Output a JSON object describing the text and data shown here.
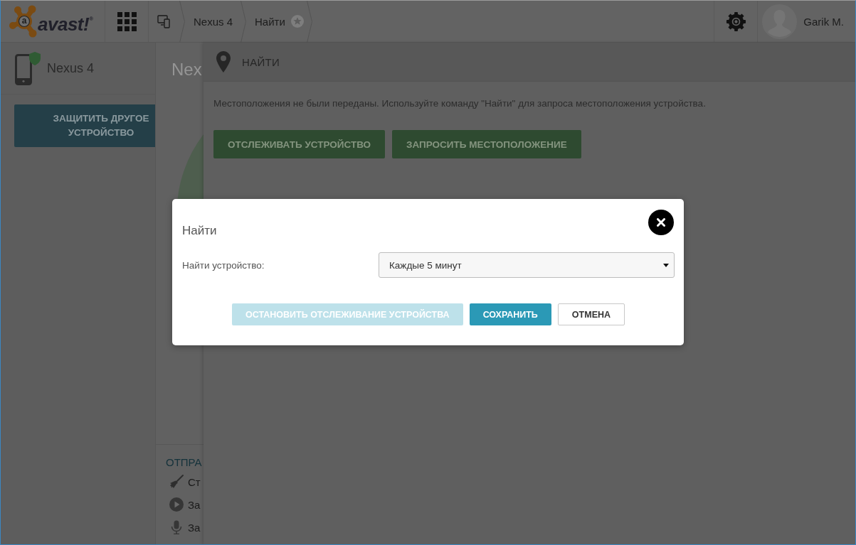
{
  "top_bar": {
    "logo": {
      "mark": "a",
      "text": "avast!$^{®}$"
    },
    "breadcrumbs": [
      {
        "label": "Nexus 4"
      },
      {
        "label": "Найти"
      }
    ],
    "user": {
      "name": "Garik M."
    }
  },
  "sidebar": {
    "device": {
      "name": "Nexus 4"
    },
    "button": "ЗАЩИТИТЬ ДРУГОЕ УСТРОЙСТВО"
  },
  "device_panel": {
    "title": "Nex",
    "section_title": "ОТПРА",
    "actions": [
      {
        "label": "Ст"
      },
      {
        "label": "За"
      },
      {
        "label": "За"
      }
    ]
  },
  "find_panel": {
    "title": "НАЙТИ",
    "message": "Местоположения не были переданы. Используйте команду \"Найти\" для запроса местоположения устройства.",
    "buttons": [
      {
        "label": "ОТСЛЕЖИВАТЬ УСТРОЙСТВО"
      },
      {
        "label": "ЗАПРОСИТЬ МЕСТОПОЛОЖЕНИЕ"
      }
    ]
  },
  "dialog": {
    "title": "Найти",
    "field": {
      "label": "Найти устройство:",
      "value": "Каждые 5 минут"
    },
    "buttons": [
      {
        "label": "ОСТАНОВИТЬ ОТСЛЕЖИВАНИЕ УСТРОЙСТВА",
        "kind": "primary",
        "disabled": true
      },
      {
        "label": "СОХРАНИТЬ",
        "kind": "primary",
        "disabled": false
      },
      {
        "label": "ОТМЕНА",
        "kind": "secondary",
        "disabled": false
      }
    ]
  }
}
